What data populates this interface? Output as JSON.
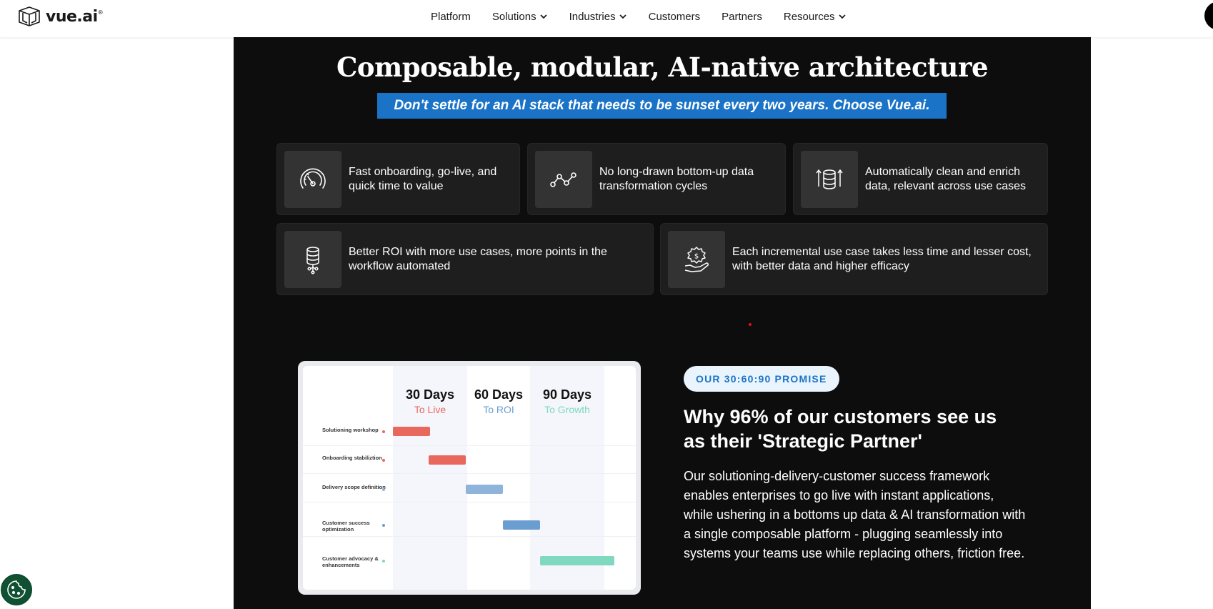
{
  "header": {
    "logo_text": "vue.ai",
    "logo_mark": "®",
    "nav": [
      {
        "label": "Platform",
        "dropdown": false
      },
      {
        "label": "Solutions",
        "dropdown": true
      },
      {
        "label": "Industries",
        "dropdown": true
      },
      {
        "label": "Customers",
        "dropdown": false
      },
      {
        "label": "Partners",
        "dropdown": false
      },
      {
        "label": "Resources",
        "dropdown": true
      }
    ]
  },
  "hero": {
    "title": "Composable, modular, AI-native architecture",
    "banner": "Don't settle for an AI stack that needs to be sunset every two years. Choose Vue.ai."
  },
  "features": [
    {
      "icon": "speedometer-icon",
      "text": "Fast onboarding, go-live, and quick time to value"
    },
    {
      "icon": "line-graph-icon",
      "text": "No long-drawn bottom-up data transformation cycles"
    },
    {
      "icon": "data-enrich-icon",
      "text": "Automatically clean and enrich data, relevant across use cases"
    },
    {
      "icon": "database-workflow-icon",
      "text": "Better ROI with more use cases, more points in the workflow automated"
    },
    {
      "icon": "money-hand-icon",
      "text": "Each incremental use case takes less time and lesser cost, with better data and higher efficacy"
    }
  ],
  "promise_chart": {
    "columns": [
      {
        "days": "30 Days",
        "sub": "To Live",
        "color": "#e8685d"
      },
      {
        "days": "60 Days",
        "sub": "To ROI",
        "color": "#6a9dd0"
      },
      {
        "days": "90 Days",
        "sub": "To Growth",
        "color": "#7fd8bf"
      }
    ],
    "rows": [
      {
        "label": "Solutioning workshop",
        "color": "#e8685d"
      },
      {
        "label": "Onboarding stabiliztion",
        "color": "#e8685d"
      },
      {
        "label": "Delivery scope definition",
        "color": "#8fb4dc"
      },
      {
        "label": "Customer success optimization",
        "color": "#6a9dd0"
      },
      {
        "label": "Customer advocacy & enhancements",
        "color": "#7fd8bf"
      }
    ]
  },
  "promise": {
    "badge": "OUR 30:60:90 PROMISE",
    "heading": "Why 96% of our customers see us as their 'Strategic Partner'",
    "body": "Our solutioning-delivery-customer success framework enables enterprises to go live with instant applications, while ushering in a bottoms up data & AI transformation with a single composable platform - plugging seamlessly into systems your teams use while replacing others, friction free."
  },
  "colors": {
    "accent": "#1a73c7",
    "dark_bg": "#0d0d0d",
    "card_bg": "#1e1e1e",
    "cookie_bg": "#0f5132"
  }
}
